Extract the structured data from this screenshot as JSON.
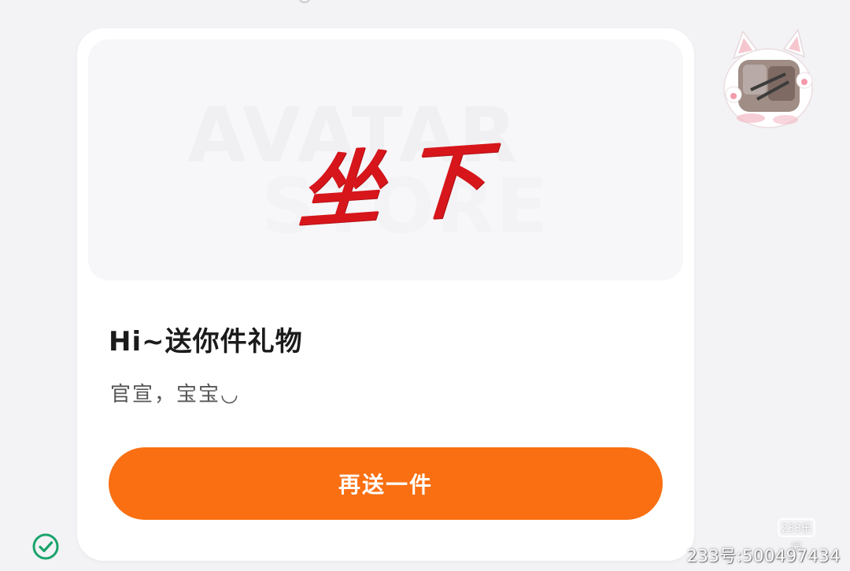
{
  "banner": {
    "watermark_line1": "AVATAR",
    "watermark_line2": "STORE",
    "calligraphy_text": "坐下",
    "calligraphy_color": "#d7161b"
  },
  "gift": {
    "title": "Hi~送你件礼物",
    "message": "官宣，宝宝◡"
  },
  "actions": {
    "resend_label": "再送一件",
    "accent_color": "#f96f12"
  },
  "status": {
    "icon": "check-circle-icon",
    "color": "#1aa36b"
  },
  "avatar": {
    "icon": "cat-avatar"
  },
  "watermark": {
    "logo_text": "233乐园",
    "id_text": "233号:500497434"
  }
}
